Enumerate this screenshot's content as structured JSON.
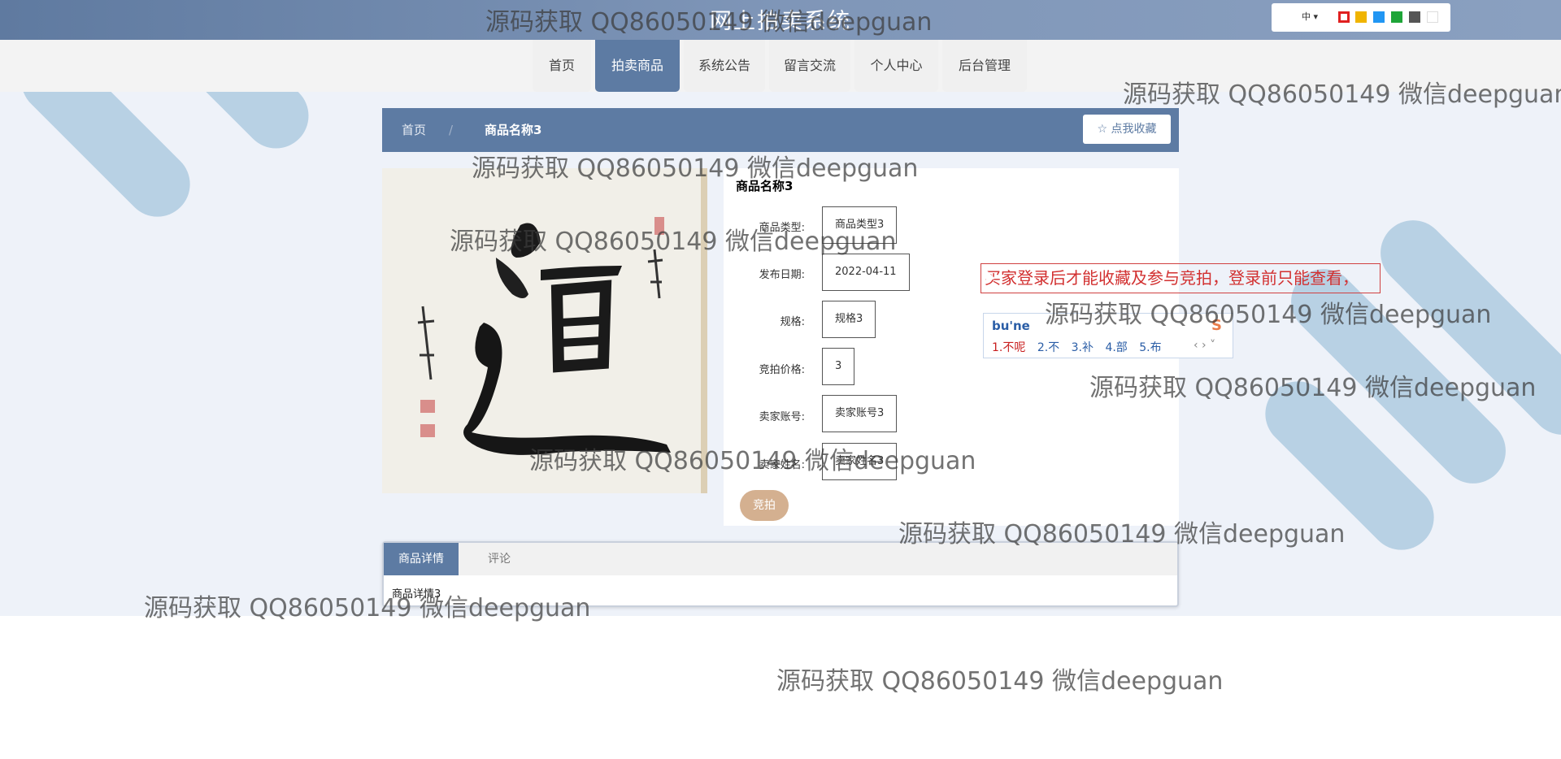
{
  "header": {
    "site_title": "网上拍卖系统",
    "language": "中",
    "theme_colors": [
      "#e02020",
      "#f0b400",
      "#2196f3",
      "#1ea538",
      "#555555",
      "#ffffff"
    ]
  },
  "nav": {
    "items": [
      {
        "label": "首页"
      },
      {
        "label": "拍卖商品"
      },
      {
        "label": "系统公告"
      },
      {
        "label": "留言交流"
      },
      {
        "label": "个人中心"
      },
      {
        "label": "后台管理"
      }
    ],
    "active": "拍卖商品"
  },
  "breadcrumb": {
    "home": "首页",
    "separator": "/",
    "current": "商品名称3",
    "favorite_label": "☆ 点我收藏"
  },
  "product": {
    "name": "商品名称3",
    "image_alt": "道",
    "fields": [
      {
        "label": "商品类型:",
        "value": "商品类型3"
      },
      {
        "label": "发布日期:",
        "value": "2022-04-11"
      },
      {
        "label": "规格:",
        "value": "规格3"
      },
      {
        "label": "竞拍价格:",
        "value": "3"
      },
      {
        "label": "卖家账号:",
        "value": "卖家账号3"
      },
      {
        "label": "卖家姓名:",
        "value": "卖家姓名3"
      }
    ],
    "bid_label": "竞拍"
  },
  "notice": "买家登录后才能收藏及参与竞拍，登录前只能查看，",
  "ime": {
    "input": "bu'ne",
    "candidates": [
      "1.不呢",
      "2.不",
      "3.补",
      "4.部",
      "5.布"
    ]
  },
  "tabs": {
    "items": [
      {
        "label": "商品详情"
      },
      {
        "label": "评论"
      }
    ],
    "active": "商品详情",
    "content": "商品详情3"
  },
  "watermark": "源码获取 QQ86050149 微信deepguan"
}
